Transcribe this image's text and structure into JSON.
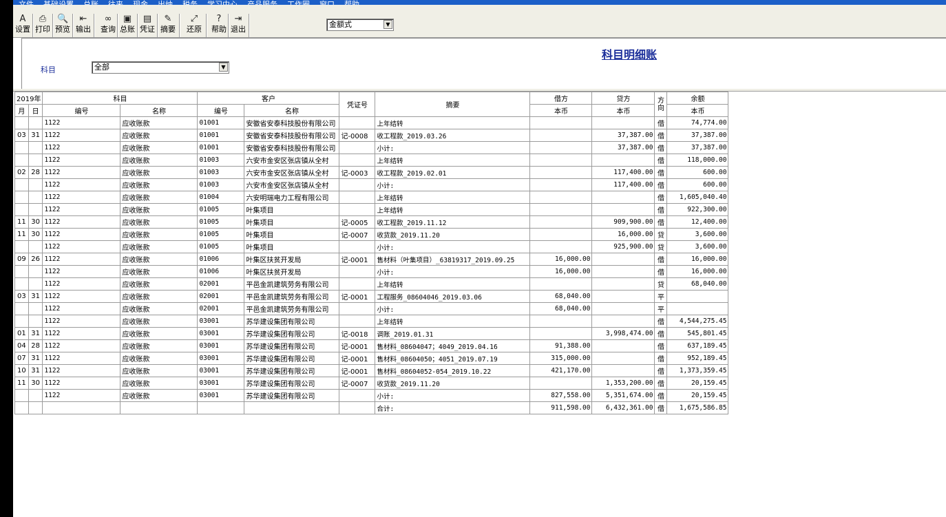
{
  "menu": [
    "文件",
    "基础设置",
    "总账",
    "往来",
    "现金",
    "出纳",
    "税务",
    "学习中心",
    "产品服务",
    "工作圈",
    "窗口",
    "帮助"
  ],
  "toolbar": {
    "buttons": [
      {
        "label": "设置",
        "icon": "settings-icon",
        "glyph": "A"
      },
      {
        "label": "打印",
        "icon": "printer-icon",
        "glyph": "⎙"
      },
      {
        "label": "预览",
        "icon": "preview-icon",
        "glyph": "🔍"
      },
      {
        "label": "输出",
        "icon": "export-icon",
        "glyph": "⇤"
      },
      {
        "label": "查询",
        "icon": "binoculars-icon",
        "glyph": "∞"
      },
      {
        "label": "总账",
        "icon": "ledger-book-icon",
        "glyph": "▣"
      },
      {
        "label": "凭证",
        "icon": "voucher-icon",
        "glyph": "▤"
      },
      {
        "label": "摘要",
        "icon": "summary-icon",
        "glyph": "✎"
      },
      {
        "label": "还原",
        "icon": "restore-icon",
        "glyph": "⤢"
      },
      {
        "label": "帮助",
        "icon": "help-icon",
        "glyph": "?"
      },
      {
        "label": "退出",
        "icon": "exit-icon",
        "glyph": "⇥"
      }
    ],
    "format_select": "金额式"
  },
  "filter": {
    "title": "科目明细账",
    "subject_label": "科目",
    "subject_value": "全部"
  },
  "table": {
    "year": "2019年",
    "h_subject": "科目",
    "h_customer": "客户",
    "h_voucher": "凭证号",
    "h_summary": "摘要",
    "h_debit": "借方",
    "h_credit": "贷方",
    "h_dir": "方向",
    "h_balance": "余额",
    "h_month": "月",
    "h_day": "日",
    "h_code": "编号",
    "h_name": "名称",
    "h_ccy": "本币",
    "rows": [
      [
        "",
        "",
        "1122",
        "应收账款",
        "01001",
        "安徽省安泰科技股份有限公司",
        "",
        "上年结转",
        "",
        "",
        "借",
        "74,774.00"
      ],
      [
        "03",
        "31",
        "1122",
        "应收账款",
        "01001",
        "安徽省安泰科技股份有限公司",
        "记-0008",
        "收工程款_2019.03.26",
        "",
        "37,387.00",
        "借",
        "37,387.00"
      ],
      [
        "",
        "",
        "1122",
        "应收账款",
        "01001",
        "安徽省安泰科技股份有限公司",
        "",
        "小计:",
        "",
        "37,387.00",
        "借",
        "37,387.00"
      ],
      [
        "",
        "",
        "1122",
        "应收账款",
        "01003",
        "六安市金安区张店镇从全村",
        "",
        "上年结转",
        "",
        "",
        "借",
        "118,000.00"
      ],
      [
        "02",
        "28",
        "1122",
        "应收账款",
        "01003",
        "六安市金安区张店镇从全村",
        "记-0003",
        "收工程款_2019.02.01",
        "",
        "117,400.00",
        "借",
        "600.00"
      ],
      [
        "",
        "",
        "1122",
        "应收账款",
        "01003",
        "六安市金安区张店镇从全村",
        "",
        "小计:",
        "",
        "117,400.00",
        "借",
        "600.00"
      ],
      [
        "",
        "",
        "1122",
        "应收账款",
        "01004",
        "六安明瑞电力工程有限公司",
        "",
        "上年结转",
        "",
        "",
        "借",
        "1,605,040.40"
      ],
      [
        "",
        "",
        "1122",
        "应收账款",
        "01005",
        "叶集项目",
        "",
        "上年结转",
        "",
        "",
        "借",
        "922,300.00"
      ],
      [
        "11",
        "30",
        "1122",
        "应收账款",
        "01005",
        "叶集项目",
        "记-0005",
        "收工程款_2019.11.12",
        "",
        "909,900.00",
        "借",
        "12,400.00"
      ],
      [
        "11",
        "30",
        "1122",
        "应收账款",
        "01005",
        "叶集项目",
        "记-0007",
        "收货款_2019.11.20",
        "",
        "16,000.00",
        "贷",
        "3,600.00"
      ],
      [
        "",
        "",
        "1122",
        "应收账款",
        "01005",
        "叶集项目",
        "",
        "小计:",
        "",
        "925,900.00",
        "贷",
        "3,600.00"
      ],
      [
        "09",
        "26",
        "1122",
        "应收账款",
        "01006",
        "叶集区扶贫开发局",
        "记-0001",
        "售材料（叶集项目）_63819317_2019.09.25",
        "16,000.00",
        "",
        "借",
        "16,000.00"
      ],
      [
        "",
        "",
        "1122",
        "应收账款",
        "01006",
        "叶集区扶贫开发局",
        "",
        "小计:",
        "16,000.00",
        "",
        "借",
        "16,000.00"
      ],
      [
        "",
        "",
        "1122",
        "应收账款",
        "02001",
        "平邑金凯建筑劳务有限公司",
        "",
        "上年结转",
        "",
        "",
        "贷",
        "68,040.00"
      ],
      [
        "03",
        "31",
        "1122",
        "应收账款",
        "02001",
        "平邑金凯建筑劳务有限公司",
        "记-0001",
        "工程服务_08604046_2019.03.06",
        "68,040.00",
        "",
        "平",
        ""
      ],
      [
        "",
        "",
        "1122",
        "应收账款",
        "02001",
        "平邑金凯建筑劳务有限公司",
        "",
        "小计:",
        "68,040.00",
        "",
        "平",
        ""
      ],
      [
        "",
        "",
        "1122",
        "应收账款",
        "03001",
        "苏华建设集团有限公司",
        "",
        "上年结转",
        "",
        "",
        "借",
        "4,544,275.45"
      ],
      [
        "01",
        "31",
        "1122",
        "应收账款",
        "03001",
        "苏华建设集团有限公司",
        "记-0018",
        "调账_2019.01.31",
        "",
        "3,998,474.00",
        "借",
        "545,801.45"
      ],
      [
        "04",
        "28",
        "1122",
        "应收账款",
        "03001",
        "苏华建设集团有限公司",
        "记-0001",
        "售材料_08604047；4049_2019.04.16",
        "91,388.00",
        "",
        "借",
        "637,189.45"
      ],
      [
        "07",
        "31",
        "1122",
        "应收账款",
        "03001",
        "苏华建设集团有限公司",
        "记-0001",
        "售材料_08604050；4051_2019.07.19",
        "315,000.00",
        "",
        "借",
        "952,189.45"
      ],
      [
        "10",
        "31",
        "1122",
        "应收账款",
        "03001",
        "苏华建设集团有限公司",
        "记-0001",
        "售材料_08604052-054_2019.10.22",
        "421,170.00",
        "",
        "借",
        "1,373,359.45"
      ],
      [
        "11",
        "30",
        "1122",
        "应收账款",
        "03001",
        "苏华建设集团有限公司",
        "记-0007",
        "收货款_2019.11.20",
        "",
        "1,353,200.00",
        "借",
        "20,159.45"
      ],
      [
        "",
        "",
        "1122",
        "应收账款",
        "03001",
        "苏华建设集团有限公司",
        "",
        "小计:",
        "827,558.00",
        "5,351,674.00",
        "借",
        "20,159.45"
      ],
      [
        "",
        "",
        "",
        "",
        "",
        "",
        "",
        "合计:",
        "911,598.00",
        "6,432,361.00",
        "借",
        "1,675,586.85"
      ]
    ]
  }
}
